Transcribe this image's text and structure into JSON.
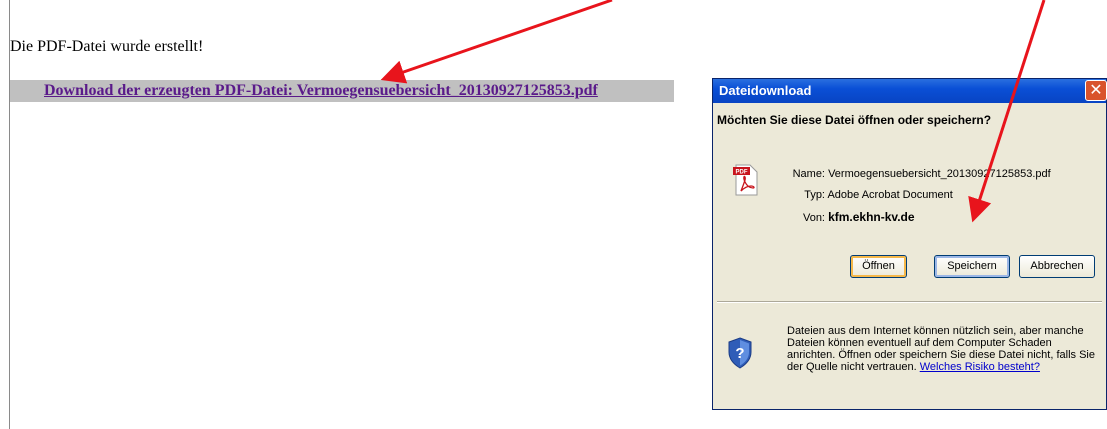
{
  "page": {
    "status": "Die PDF-Datei wurde erstellt!",
    "download_link": "Download der erzeugten PDF-Datei: Vermoegensuebersicht_20130927125853.pdf"
  },
  "dialog": {
    "title": "Dateidownload",
    "close_glyph": "✕",
    "question": "Möchten Sie diese Datei öffnen oder speichern?",
    "name_label": "Name:",
    "name_value": "Vermoegensuebersicht_20130927125853.pdf",
    "type_label": "Typ:",
    "type_value": "Adobe Acrobat Document",
    "from_label": "Von:",
    "from_value": "kfm.ekhn-kv.de",
    "buttons": {
      "open": "Öffnen",
      "save": "Speichern",
      "cancel": "Abbrechen"
    },
    "warning_text": "Dateien aus dem Internet können nützlich sein, aber manche Dateien können eventuell auf dem Computer Schaden anrichten. Öffnen oder speichern Sie diese Datei nicht, falls Sie der Quelle nicht vertrauen.",
    "risk_link": "Welches Risiko besteht?",
    "pdf_icon_label": "PDF"
  },
  "colors": {
    "link": "#5a1a8a",
    "bar": "#c0c0c0",
    "arrow": "#e8141c",
    "titlebar": "#0a4fd6"
  }
}
